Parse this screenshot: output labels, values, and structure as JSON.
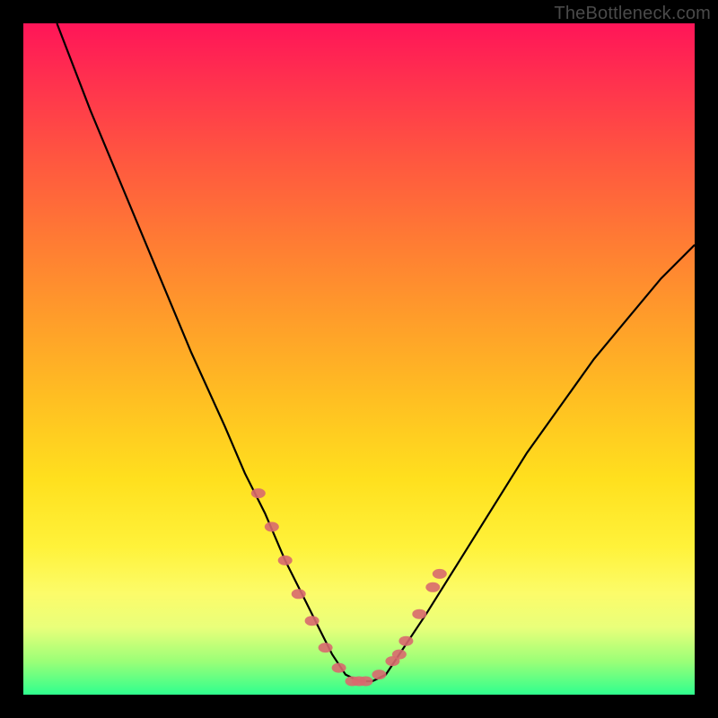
{
  "watermark": "TheBottleneck.com",
  "chart_data": {
    "type": "line",
    "title": "",
    "xlabel": "",
    "ylabel": "",
    "xlim": [
      0,
      100
    ],
    "ylim": [
      0,
      100
    ],
    "series": [
      {
        "name": "bottleneck-curve",
        "x": [
          5,
          10,
          15,
          20,
          25,
          30,
          33,
          36,
          39,
          42,
          44,
          46,
          48,
          50,
          52,
          54,
          56,
          60,
          65,
          70,
          75,
          80,
          85,
          90,
          95,
          100
        ],
        "values": [
          100,
          87,
          75,
          63,
          51,
          40,
          33,
          27,
          20,
          14,
          10,
          6,
          3,
          2,
          2,
          3,
          6,
          12,
          20,
          28,
          36,
          43,
          50,
          56,
          62,
          67
        ]
      }
    ],
    "markers": {
      "name": "highlighted-points",
      "color": "#d8696e",
      "x": [
        35,
        37,
        39,
        41,
        43,
        45,
        47,
        49,
        50,
        51,
        53,
        55,
        56,
        57,
        59,
        61,
        62
      ],
      "values": [
        30,
        25,
        20,
        15,
        11,
        7,
        4,
        2,
        2,
        2,
        3,
        5,
        6,
        8,
        12,
        16,
        18
      ]
    },
    "gradient_stops": [
      {
        "pos": 0.0,
        "color": "#ff1558"
      },
      {
        "pos": 0.2,
        "color": "#ff5640"
      },
      {
        "pos": 0.44,
        "color": "#ff9d2a"
      },
      {
        "pos": 0.68,
        "color": "#ffe01e"
      },
      {
        "pos": 0.9,
        "color": "#e9ff7a"
      },
      {
        "pos": 1.0,
        "color": "#2fff8e"
      }
    ]
  }
}
